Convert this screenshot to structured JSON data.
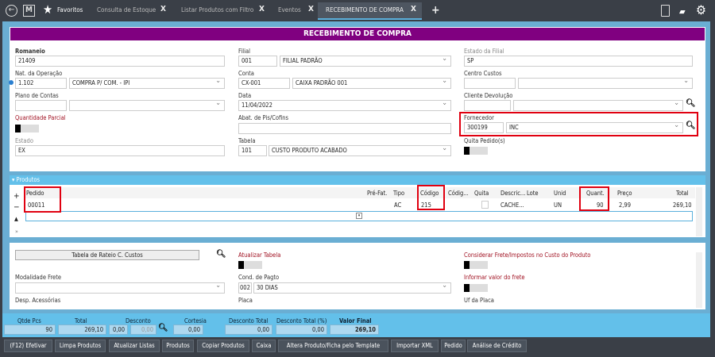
{
  "topbar": {
    "favorites": "Favoritos",
    "tabs": [
      {
        "label": "Consulta de Estoque"
      },
      {
        "label": "Listar Produtos com Filtro"
      },
      {
        "label": "Eventos"
      },
      {
        "label": "RECEBIMENTO DE COMPRA",
        "active": true
      }
    ],
    "close": "X",
    "add": "+"
  },
  "form": {
    "title": "RECEBIMENTO DE COMPRA",
    "romaneio": {
      "label": "Romaneio",
      "value": "21409"
    },
    "nat_operacao": {
      "label": "Nat. da Operação",
      "code": "1.102",
      "value": "COMPRA P/ COM. - IPI"
    },
    "plano_contas": {
      "label": "Plano de Contas",
      "code": "",
      "value": ""
    },
    "quantidade_parcial": {
      "label": "Quantidade Parcial",
      "on": false
    },
    "estado": {
      "label": "Estado",
      "value": "EX"
    },
    "filial": {
      "label": "Filial",
      "code": "001",
      "value": "FILIAL PADRÃO"
    },
    "conta": {
      "label": "Conta",
      "code": "CX-001",
      "value": "CAIXA PADRÃO 001"
    },
    "data": {
      "label": "Data",
      "value": "11/04/2022"
    },
    "abat": {
      "label": "Abat. de Pis/Cofins",
      "value": ""
    },
    "tabela": {
      "label": "Tabela",
      "code": "101",
      "value": "CUSTO PRODUTO ACABADO"
    },
    "estado_filial": {
      "label": "Estado da Filial",
      "value": "SP"
    },
    "centro_custos": {
      "label": "Centro Custos",
      "code": "",
      "value": ""
    },
    "cliente_devolucao": {
      "label": "Cliente Devolução",
      "code": "",
      "value": ""
    },
    "fornecedor": {
      "label": "Fornecedor",
      "code": "300199",
      "value": "INC"
    },
    "quita_pedidos": {
      "label": "Quita Pedido(s)",
      "on": false
    }
  },
  "produtos": {
    "title": "Produtos",
    "columns": [
      "Pedido",
      "Pré-Fat.",
      "Tipo",
      "Código",
      "Códig...",
      "Quita",
      "Descric...",
      "Lote",
      "Unid",
      "Quant.",
      "Preço",
      "Total"
    ],
    "rows": [
      {
        "pedido": "00011",
        "pre_fat": "",
        "tipo": "AC",
        "codigo": "215",
        "codigo2": "",
        "quita": false,
        "descricao": "CACHE...",
        "lote": "",
        "unid": "UN",
        "quant": "90",
        "preco": "2,99",
        "total": "269,10"
      }
    ],
    "side": {
      "add": "+",
      "remove": "−",
      "up": "▲",
      "more": "»"
    }
  },
  "extra": {
    "rateio_button": "Tabela de Rateio C. Custos",
    "atualizar_tabela": "Atualizar Tabela",
    "considerar_frete": "Considerar Frete/Impostos no Custo do Produto",
    "modalidade_frete": "Modalidade Frete",
    "cond_pagto": {
      "label": "Cond. de Pagto",
      "code": "002",
      "value": "30 DIAS"
    },
    "informar_frete": "Informar valor do frete",
    "desp_acessorias": "Desp. Acessórias",
    "placa": "Placa",
    "uf_placa": "Uf da Placa"
  },
  "totals": {
    "qtde_pcs": {
      "label": "Qtde Pcs",
      "value": "90"
    },
    "total": {
      "label": "Total",
      "value": "269,10"
    },
    "desconto": {
      "label": "Desconto",
      "value": "0,00",
      "value2": "0,00"
    },
    "cortesia": {
      "label": "Cortesia",
      "value": "0,00"
    },
    "desconto_total": {
      "label": "Desconto Total",
      "value": "0,00"
    },
    "desconto_total_pct": {
      "label": "Desconto Total (%)",
      "value": "0,00"
    },
    "valor_final": {
      "label": "Valor Final",
      "value": "269,10"
    }
  },
  "actions": [
    "(F12) Efetivar",
    "Limpa Produtos",
    "Atualizar Listas",
    "Produtos",
    "Copiar Produtos",
    "Caixa",
    "Altera Produto/Ficha pelo Template",
    "Importar XML",
    "Pedido",
    "Análise de Crédito"
  ],
  "colors": {
    "header": "#800080",
    "frame": "#6aaed3",
    "topbar": "#3a3f47",
    "highlight": "#e00010"
  }
}
